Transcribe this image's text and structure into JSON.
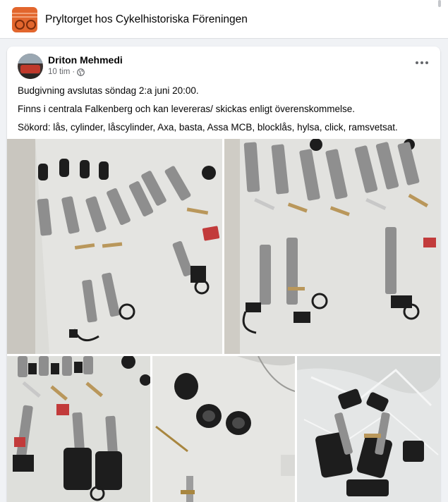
{
  "group": {
    "name": "Pryltorget hos Cykelhistoriska Föreningen"
  },
  "post": {
    "author": "Driton Mehmedi",
    "time": "10 tim",
    "separator": "·",
    "privacy_icon": "globe-icon",
    "menu_icon": "more-options-icon",
    "paragraphs": [
      "Budgivning avslutas söndag 2:a juni 20:00.",
      "Finns i centrala Falkenberg och kan levereras/ skickas enligt överenskommelse.",
      "Sökord: lås, cylinder, låscylinder, Axa, basta, Assa MCB, blocklås, hylsa, click, ramsvetsat."
    ]
  },
  "colors": {
    "page_background": "#f0f2f5",
    "card_background": "#ffffff",
    "secondary_text": "#65676b",
    "group_avatar": "#e2662d"
  }
}
